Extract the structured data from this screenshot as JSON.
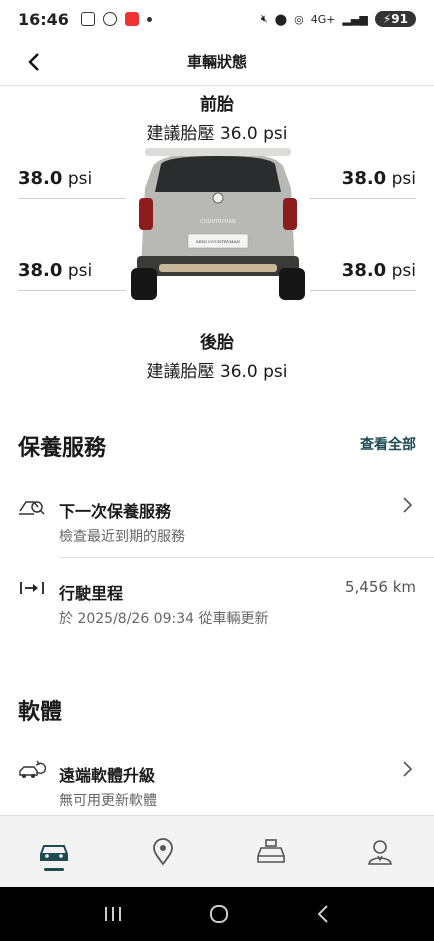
{
  "status_bar": {
    "time": "16:46",
    "network": "4G+",
    "battery": "91"
  },
  "header": {
    "title": "車輛狀態"
  },
  "tires": {
    "front_title": "前胎",
    "front_recommended": "建議胎壓 36.0 psi",
    "rear_title": "後胎",
    "rear_recommended": "建議胎壓 36.0 psi",
    "front_left": {
      "value": "38.0",
      "unit": "psi"
    },
    "front_right": {
      "value": "38.0",
      "unit": "psi"
    },
    "rear_left": {
      "value": "38.0",
      "unit": "psi"
    },
    "rear_right": {
      "value": "38.0",
      "unit": "psi"
    }
  },
  "car": {
    "badge": "COUNTRYMAN",
    "plate": "MINI COUNTRYMAN"
  },
  "maintenance": {
    "title": "保養服務",
    "view_all": "查看全部",
    "next_service": {
      "title": "下一次保養服務",
      "subtitle": "檢查最近到期的服務",
      "icon": "service-icon"
    },
    "mileage": {
      "title": "行駛里程",
      "subtitle": "於 2025/8/26 09:34 從車輛更新",
      "value": "5,456 km",
      "icon": "odometer-icon"
    }
  },
  "software": {
    "title": "軟體",
    "remote_update": {
      "title": "遠端軟體升級",
      "subtitle": "無可用更新軟體",
      "icon": "car-update-icon"
    }
  },
  "bottom_nav": [
    {
      "name": "vehicle",
      "icon": "car-icon",
      "active": true
    },
    {
      "name": "location",
      "icon": "map-pin-icon",
      "active": false
    },
    {
      "name": "services",
      "icon": "car-service-icon",
      "active": false
    },
    {
      "name": "profile",
      "icon": "user-icon",
      "active": false
    }
  ],
  "colors": {
    "accent": "#1e4a52",
    "divider": "#e2e2e2",
    "nav_bg": "#f3f3f3"
  }
}
